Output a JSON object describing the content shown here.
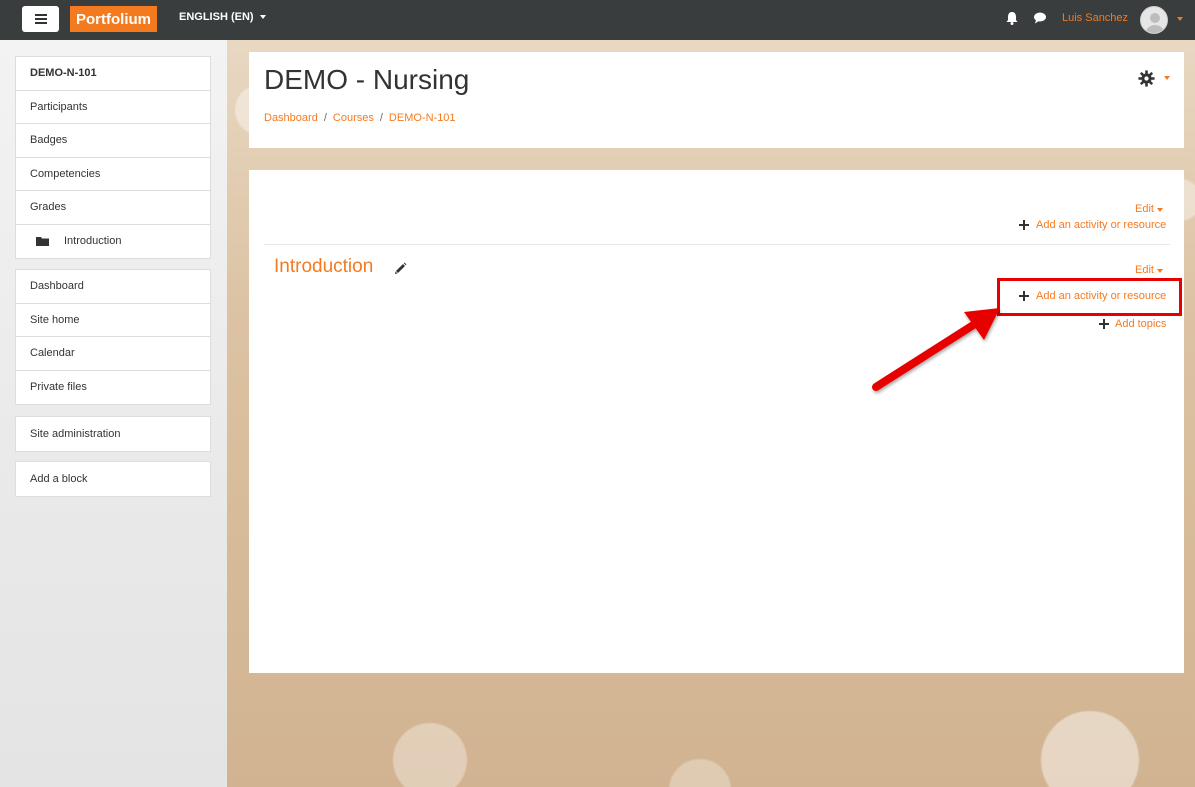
{
  "navbar": {
    "brand": "Portfolium",
    "language": "ENGLISH (EN)",
    "username": "Luis Sanchez",
    "icons": [
      "menu-icon",
      "bell-icon",
      "chat-icon",
      "avatar"
    ]
  },
  "sidebar": {
    "course_block": [
      {
        "label": "DEMO-N-101"
      },
      {
        "label": "Participants"
      },
      {
        "label": "Badges"
      },
      {
        "label": "Competencies"
      },
      {
        "label": "Grades"
      },
      {
        "label": "Introduction"
      }
    ],
    "nav_block": [
      {
        "label": "Dashboard"
      },
      {
        "label": "Site home"
      },
      {
        "label": "Calendar"
      },
      {
        "label": "Private files"
      }
    ],
    "admin_block": [
      {
        "label": "Site administration"
      }
    ],
    "addblock_block": [
      {
        "label": "Add a block"
      }
    ]
  },
  "header": {
    "title": "DEMO - Nursing",
    "breadcrumb": [
      "Dashboard",
      "Courses",
      "DEMO-N-101"
    ],
    "breadcrumb_separator": "/"
  },
  "course": {
    "top_section": {
      "edit_label": "Edit",
      "add_activity_label": "Add an activity or resource"
    },
    "intro_section": {
      "title": "Introduction",
      "edit_label": "Edit",
      "add_activity_label": "Add an activity or resource",
      "add_topics_label": "Add topics"
    }
  },
  "colors": {
    "accent": "#f47a20",
    "navbar_bg": "#3a3d3d",
    "annotation": "#e60000"
  }
}
